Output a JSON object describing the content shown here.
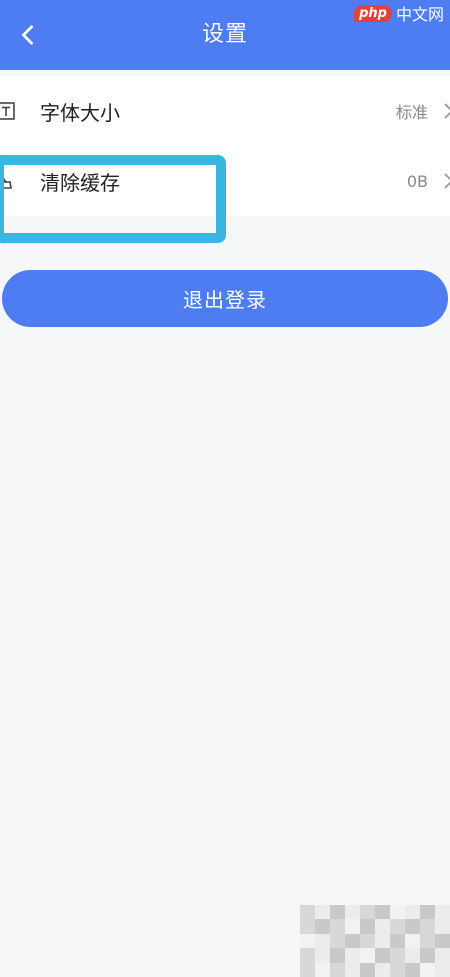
{
  "header": {
    "title": "设置",
    "watermark_badge": "php",
    "watermark_text": "中文网"
  },
  "settings": {
    "items": [
      {
        "label": "字体大小",
        "value": "标准"
      },
      {
        "label": "清除缓存",
        "value": "0B"
      }
    ]
  },
  "logout_label": "退出登录",
  "colors": {
    "primary": "#4e7cf3",
    "highlight": "#3ab7e0",
    "background": "#f6f7f9"
  },
  "icons": {
    "back": "chevron-left-icon",
    "font_size": "text-size-icon",
    "clear_cache": "broom-icon",
    "row_arrow": "chevron-right-icon"
  }
}
